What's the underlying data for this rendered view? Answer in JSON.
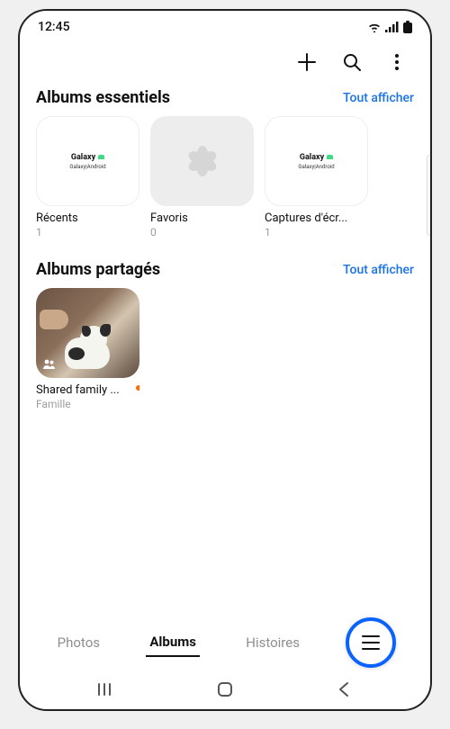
{
  "status": {
    "time": "12:45"
  },
  "header": {
    "add_icon": "plus-icon",
    "search_icon": "search-icon",
    "more_icon": "more-vertical-icon"
  },
  "sections": {
    "essentials": {
      "title": "Albums essentiels",
      "show_all": "Tout afficher",
      "albums": [
        {
          "name": "Récents",
          "count": "1",
          "thumb_logo": "Galaxy",
          "thumb_sub": "Galaxy|Android"
        },
        {
          "name": "Favoris",
          "count": "0"
        },
        {
          "name": "Captures d'écr...",
          "count": "1",
          "thumb_logo": "Galaxy",
          "thumb_sub": "Galaxy|Android"
        }
      ]
    },
    "shared": {
      "title": "Albums partagés",
      "show_all": "Tout afficher",
      "albums": [
        {
          "name": "Shared family ...",
          "subtitle": "Famille",
          "has_notification": true
        }
      ]
    }
  },
  "tabs": {
    "items": [
      {
        "label": "Photos",
        "active": false
      },
      {
        "label": "Albums",
        "active": true
      },
      {
        "label": "Histoires",
        "active": false
      }
    ],
    "menu_icon": "hamburger-icon"
  }
}
